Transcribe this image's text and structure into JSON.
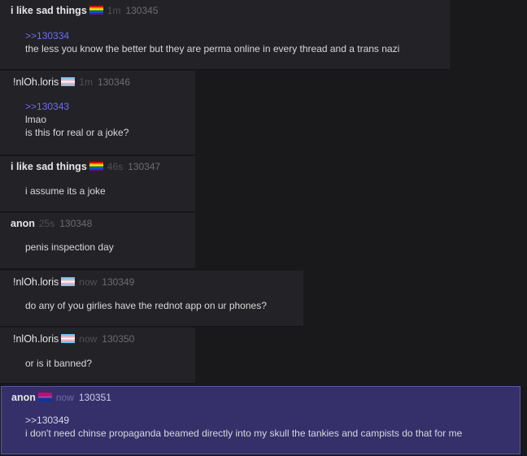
{
  "posts": [
    {
      "name": "i like sad things",
      "flag": "rainbow-flag",
      "time": "1m",
      "num": "130345",
      "quote": ">>130334",
      "lines": [
        "the less you know the better but they are perma online in every thread and a trans nazi"
      ]
    },
    {
      "name": "!nlOh.loris",
      "flag": "trans-flag",
      "time": "1m",
      "num": "130346",
      "quote": ">>130343",
      "lines": [
        "lmao",
        "is this for  real or a joke?"
      ]
    },
    {
      "name": "i like sad things",
      "flag": "rainbow-flag",
      "time": "46s",
      "num": "130347",
      "quote": "",
      "lines": [
        "i assume its a joke"
      ]
    },
    {
      "name": "anon",
      "flag": "",
      "time": "25s",
      "num": "130348",
      "quote": "",
      "lines": [
        "penis inspection day"
      ]
    },
    {
      "name": "!nlOh.loris",
      "flag": "trans-flag",
      "time": "now",
      "num": "130349",
      "quote": "",
      "lines": [
        "do any of you girlies have the rednot app on ur phones?"
      ]
    },
    {
      "name": "!nlOh.loris",
      "flag": "trans-flag",
      "time": "now",
      "num": "130350",
      "quote": "",
      "lines": [
        "or is it banned?"
      ]
    },
    {
      "name": "anon",
      "flag": "bi-flag",
      "time": "now",
      "num": "130351",
      "quote": ">>130349",
      "lines": [
        "i don't need chinse propaganda beamed directly into my skull the tankies and campists do that for me"
      ]
    }
  ],
  "colors": {
    "background": "#19191c",
    "post": "#232327",
    "own_post": "#35306a",
    "quote_link": "#6b6bff"
  }
}
